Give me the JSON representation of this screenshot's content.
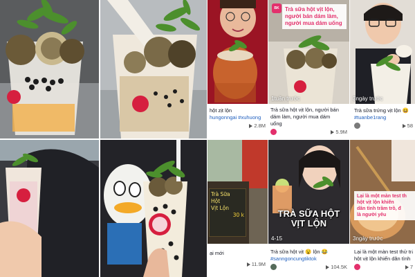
{
  "tiles": [
    {
      "photo": "bubble-tea-balut-eggs-cup"
    },
    {
      "photo": "pouring-tea-into-cup"
    },
    {
      "caption_line1": "hột zịt lộn",
      "caption_line2": "hungonngai #xuhuong",
      "views": "2.8M"
    },
    {
      "overlay_line1": "Trà sữa hột vịt lộn,",
      "overlay_line2": "người bán dám làm,",
      "overlay_line3": "người mua dám uống",
      "date": "1tuần trước",
      "caption_line1": "Trà sữa hột vịt lộn, người bán",
      "caption_line2": "dám làm, người mua dám",
      "caption_line3": "uống",
      "views": "5.9M"
    },
    {
      "date": "3ngày trước",
      "caption_line1": "Trà sữa trứng vịt lộn 😆",
      "caption_line2": "#tuanbe1rang",
      "views": "58"
    },
    {
      "photo": "person-holding-cup-black-sweater"
    },
    {
      "photo": "cup-in-front-of-duck-shirt"
    },
    {
      "sign_line1": "Trà Sữa",
      "sign_line2": "Hột",
      "sign_line3": "Vịt Lộn",
      "sign_price": "30 k",
      "caption_line1": "ại mới",
      "views": "11.9M"
    },
    {
      "title_line1": "TRÀ SỮA HỘT",
      "title_line2": "VỊT LỘN",
      "date": "4-15",
      "caption_line1": "Trà sữa hột vịt 😧 lộn 😂",
      "caption_line2": "#sanngoncungtiktok",
      "views": "104.5K"
    },
    {
      "overlay_line1": "Lại là một màn test th",
      "overlay_line2": "hột vịt lộn khiến",
      "overlay_line3": "dân tình trầm trồ, đ",
      "overlay_line4": "là người yêu",
      "date": "3ngày trước",
      "caption_line1": "Lại là một màn test thử trà",
      "caption_line2": "hột vịt lộn khiến dân tình",
      "views": "7"
    }
  ],
  "colors": {
    "hashtag": "#1f5fbf",
    "brand_pink": "#e3306c",
    "caption_text": "#161823"
  }
}
